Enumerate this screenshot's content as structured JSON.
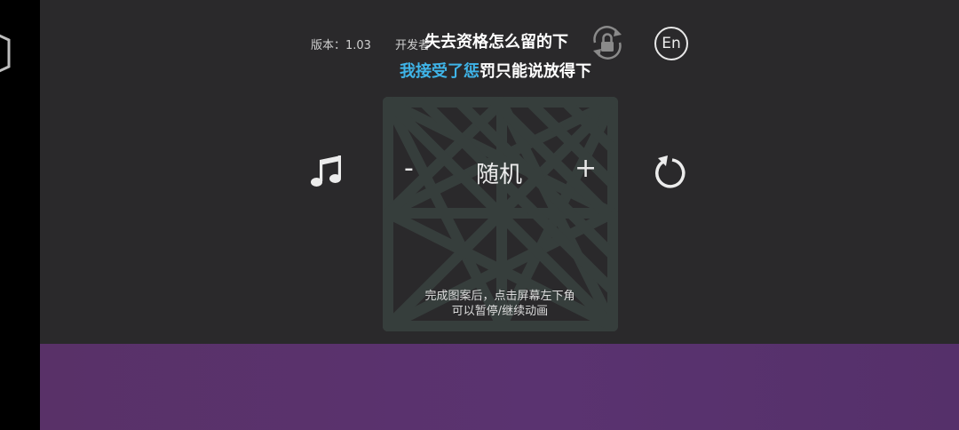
{
  "header": {
    "version": "版本：1.03",
    "developer": "开发者",
    "lock_icon": "rotation-lock-icon",
    "language_button": "En"
  },
  "lyrics": {
    "line1": "失去资格怎么留的下",
    "line2_highlight": "我接受了惩",
    "line2_rest": "罚只能说放得下",
    "highlight_color": "#3fb4e8"
  },
  "controls": {
    "music_icon": "music-note-icon",
    "minus": "-",
    "mode": "随机",
    "plus": "+",
    "refresh_icon": "refresh-icon"
  },
  "hint": {
    "line1": "完成图案后，点击屏幕左下角",
    "line2": "可以暂停/继续动画"
  },
  "colors": {
    "background": "#2a292b",
    "bottom_bar": "#5a3370",
    "side_bar": "#000000"
  }
}
